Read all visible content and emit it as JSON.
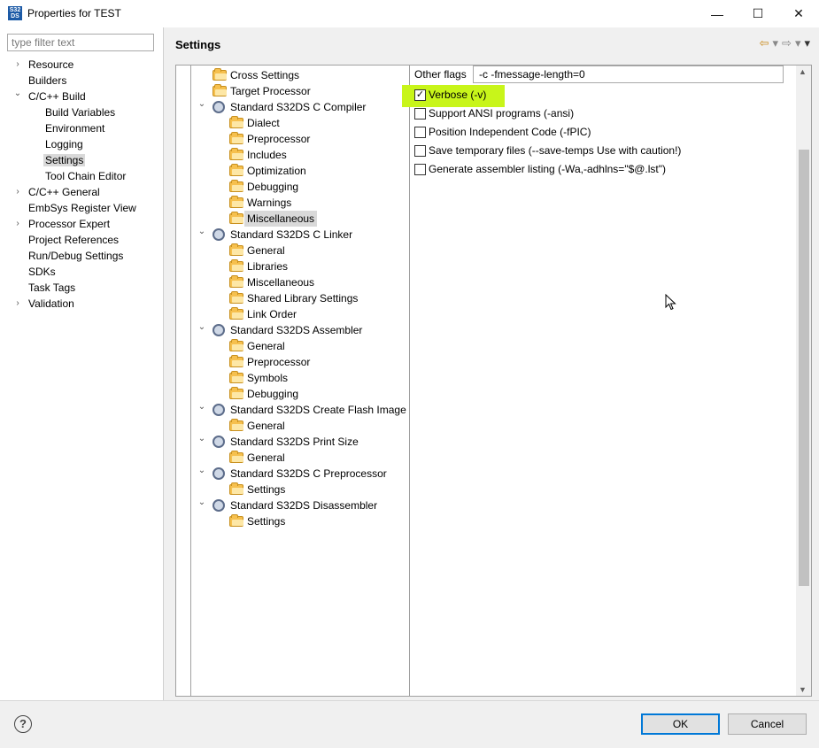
{
  "window": {
    "title": "Properties for TEST",
    "app_icon_text": "S32 DS",
    "minimize": "—",
    "maximize": "☐",
    "close": "✕"
  },
  "left_panel": {
    "filter_placeholder": "type filter text",
    "items": [
      {
        "label": "Resource",
        "expander": "›"
      },
      {
        "label": "Builders",
        "expander": ""
      },
      {
        "label": "C/C++ Build",
        "expander": "⌄"
      },
      {
        "label": "Build Variables",
        "expander": ""
      },
      {
        "label": "Environment",
        "expander": ""
      },
      {
        "label": "Logging",
        "expander": ""
      },
      {
        "label": "Settings",
        "expander": ""
      },
      {
        "label": "Tool Chain Editor",
        "expander": ""
      },
      {
        "label": "C/C++ General",
        "expander": "›"
      },
      {
        "label": "EmbSys Register View",
        "expander": ""
      },
      {
        "label": "Processor Expert",
        "expander": "›"
      },
      {
        "label": "Project References",
        "expander": ""
      },
      {
        "label": "Run/Debug Settings",
        "expander": ""
      },
      {
        "label": "SDKs",
        "expander": ""
      },
      {
        "label": "Task Tags",
        "expander": ""
      },
      {
        "label": "Validation",
        "expander": "›"
      }
    ]
  },
  "header": {
    "title": "Settings"
  },
  "tool_tree": [
    {
      "label": "Cross Settings",
      "icon": "folder-gear-icon"
    },
    {
      "label": "Target Processor",
      "icon": "folder-gear-icon"
    },
    {
      "label": "Standard S32DS C Compiler",
      "icon": "tool-icon",
      "expander": "⌄"
    },
    {
      "label": "Dialect",
      "icon": "folder-gear-icon"
    },
    {
      "label": "Preprocessor",
      "icon": "folder-gear-icon"
    },
    {
      "label": "Includes",
      "icon": "folder-gear-icon"
    },
    {
      "label": "Optimization",
      "icon": "folder-gear-icon"
    },
    {
      "label": "Debugging",
      "icon": "folder-gear-icon"
    },
    {
      "label": "Warnings",
      "icon": "folder-gear-icon"
    },
    {
      "label": "Miscellaneous",
      "icon": "folder-gear-icon"
    },
    {
      "label": "Standard S32DS C Linker",
      "icon": "tool-icon",
      "expander": "⌄"
    },
    {
      "label": "General",
      "icon": "folder-gear-icon"
    },
    {
      "label": "Libraries",
      "icon": "folder-gear-icon"
    },
    {
      "label": "Miscellaneous",
      "icon": "folder-gear-icon"
    },
    {
      "label": "Shared Library Settings",
      "icon": "folder-gear-icon"
    },
    {
      "label": "Link Order",
      "icon": "folder-gear-icon"
    },
    {
      "label": "Standard S32DS Assembler",
      "icon": "tool-icon",
      "expander": "⌄"
    },
    {
      "label": "General",
      "icon": "folder-gear-icon"
    },
    {
      "label": "Preprocessor",
      "icon": "folder-gear-icon"
    },
    {
      "label": "Symbols",
      "icon": "folder-gear-icon"
    },
    {
      "label": "Debugging",
      "icon": "folder-gear-icon"
    },
    {
      "label": "Standard S32DS Create Flash Image",
      "icon": "tool-icon",
      "expander": "⌄"
    },
    {
      "label": "General",
      "icon": "folder-gear-icon"
    },
    {
      "label": "Standard S32DS Print Size",
      "icon": "tool-icon",
      "expander": "⌄"
    },
    {
      "label": "General",
      "icon": "folder-gear-icon"
    },
    {
      "label": "Standard S32DS C Preprocessor",
      "icon": "tool-icon",
      "expander": "⌄"
    },
    {
      "label": "Settings",
      "icon": "folder-gear-icon"
    },
    {
      "label": "Standard S32DS Disassembler",
      "icon": "tool-icon",
      "expander": "⌄"
    },
    {
      "label": "Settings",
      "icon": "folder-gear-icon"
    }
  ],
  "options": {
    "other_flags_label": "Other flags",
    "other_flags_value": "-c -fmessage-length=0",
    "checkboxes": [
      {
        "label": "Verbose (-v)",
        "checked": true,
        "mark": "✓"
      },
      {
        "label": "Support ANSI programs (-ansi)",
        "checked": false,
        "mark": ""
      },
      {
        "label": "Position Independent Code (-fPIC)",
        "checked": false,
        "mark": ""
      },
      {
        "label": "Save temporary files (--save-temps Use with caution!)",
        "checked": false,
        "mark": ""
      },
      {
        "label": "Generate assembler listing (-Wa,-adhlns=\"$@.lst\")",
        "checked": false,
        "mark": ""
      }
    ],
    "highlight_color": "#c8f51a"
  },
  "footer": {
    "help": "?",
    "ok_label": "OK",
    "cancel_label": "Cancel"
  }
}
